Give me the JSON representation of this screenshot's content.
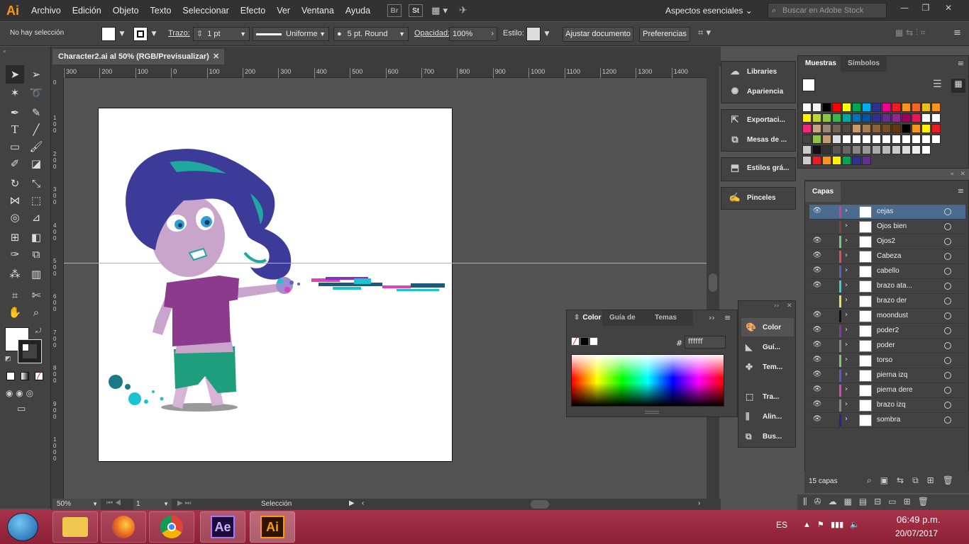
{
  "app": {
    "logo": "Ai"
  },
  "menu": [
    "Archivo",
    "Edición",
    "Objeto",
    "Texto",
    "Seleccionar",
    "Efecto",
    "Ver",
    "Ventana",
    "Ayuda"
  ],
  "bridge_icons": [
    "Br",
    "St"
  ],
  "workspace": {
    "label": "Aspectos esenciales",
    "search_placeholder": "Buscar en Adobe Stock"
  },
  "control": {
    "selection": "No hay selección",
    "stroke_label": "Trazo:",
    "stroke_weight": "1 pt",
    "profile": "Uniforme",
    "brush": "5 pt. Round",
    "opacity_label": "Opacidad:",
    "opacity": "100%",
    "style_label": "Estilo:",
    "fit_doc": "Ajustar documento",
    "prefs": "Preferencias"
  },
  "document": {
    "tab_title": "Character2.ai al 50% (RGB/Previsualizar)",
    "ruler_h": [
      "300",
      "200",
      "100",
      "0",
      "100",
      "200",
      "300",
      "400",
      "500",
      "600",
      "700",
      "800",
      "900",
      "1000",
      "1100",
      "1200",
      "1300",
      "1400"
    ],
    "ruler_v": [
      "0",
      "1 0 0",
      "2 0 0",
      "3 0 0",
      "4 0 0",
      "5 0 0",
      "6 0 0",
      "7 0 0",
      "8 0 0",
      "9 0 0",
      "1 0 0 0"
    ],
    "zoom": "50%",
    "artboard_num": "1",
    "status_tool": "Selección"
  },
  "dock": {
    "group1": [
      {
        "label": "Libraries",
        "icon": "libraries-icon"
      },
      {
        "label": "Apariencia",
        "icon": "appearance-icon"
      }
    ],
    "group2": [
      {
        "label": "Exportaci...",
        "icon": "export-icon"
      },
      {
        "label": "Mesas de ...",
        "icon": "artboards-icon"
      }
    ],
    "group3": [
      {
        "label": "Estilos grá...",
        "icon": "graphic-styles-icon"
      }
    ],
    "group4": [
      {
        "label": "Pinceles",
        "icon": "brushes-icon"
      }
    ]
  },
  "swatches": {
    "tabs": [
      "Muestras",
      "Símbolos"
    ]
  },
  "layers": {
    "tab": "Capas",
    "items": [
      {
        "name": "cejas",
        "visible": true,
        "color": "#e0389a",
        "selected": true
      },
      {
        "name": "Ojos bien",
        "visible": false,
        "color": "#8a3c3c"
      },
      {
        "name": "Ojos2",
        "visible": true,
        "color": "#6fd06f"
      },
      {
        "name": "Cabeza",
        "visible": true,
        "color": "#e05050"
      },
      {
        "name": "cabello",
        "visible": true,
        "color": "#5a5ad0"
      },
      {
        "name": "brazo ata...",
        "visible": true,
        "color": "#30d0e0"
      },
      {
        "name": "brazo der",
        "visible": false,
        "color": "#f0e050"
      },
      {
        "name": "moondust",
        "visible": true,
        "color": "#111111"
      },
      {
        "name": "poder2",
        "visible": true,
        "color": "#8a30c0"
      },
      {
        "name": "poder",
        "visible": true,
        "color": "#888888"
      },
      {
        "name": "torso",
        "visible": true,
        "color": "#6fd06f"
      },
      {
        "name": "pierna izq",
        "visible": true,
        "color": "#5a5ad0"
      },
      {
        "name": "pierna dere",
        "visible": true,
        "color": "#e040c0"
      },
      {
        "name": "brazo izq",
        "visible": true,
        "color": "#888888"
      },
      {
        "name": "sombra",
        "visible": true,
        "color": "#2020b0"
      }
    ],
    "count": "15 capas"
  },
  "color_panel": {
    "tabs": [
      "Color",
      "Guía de col",
      "Temas de c"
    ],
    "hex_label": "#",
    "hex": "ffffff"
  },
  "float_dock": [
    {
      "label": "Color",
      "icon": "color-icon"
    },
    {
      "label": "Guí...",
      "icon": "color-guide-icon"
    },
    {
      "label": "Tem...",
      "icon": "color-themes-icon"
    },
    {
      "label": "Tra...",
      "icon": "transform-icon"
    },
    {
      "label": "Alin...",
      "icon": "align-icon"
    },
    {
      "label": "Bus...",
      "icon": "pathfinder-icon"
    }
  ],
  "taskbar": {
    "apps": [
      "Explorador",
      "Firefox",
      "Chrome",
      "Ae",
      "Ai"
    ],
    "lang": "ES",
    "time": "06:49 p.m.",
    "date": "20/07/2017"
  }
}
